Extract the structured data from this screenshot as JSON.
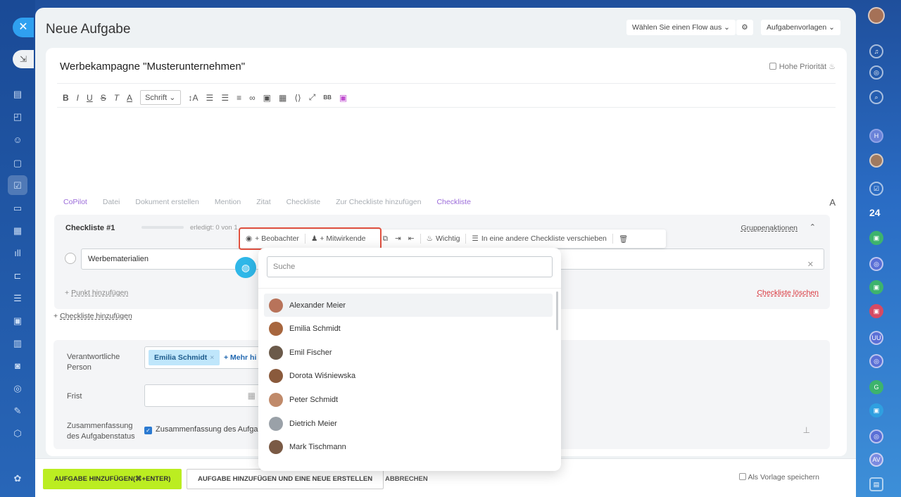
{
  "title": "Neue Aufgabe",
  "flow_select": "Wählen Sie einen Flow aus",
  "templates": "Aufgabenvorlagen",
  "task_name": "Werbekampagne \"Musterunternehmen\"",
  "high_priority": "Hohe Priorität",
  "font_select": "Schrift",
  "bottom_toolbar": [
    "CoPilot",
    "Datei",
    "Dokument erstellen",
    "Mention",
    "Zitat",
    "Checkliste",
    "Zur Checkliste hinzufügen",
    "Checkliste"
  ],
  "checklist": {
    "title": "Checkliste #1",
    "done": "erledigt: 0 von 1",
    "group_actions": "Gruppenaktionen",
    "item": "Werbematerialien",
    "add_point": "Punkt hinzufügen",
    "delete": "Checkliste löschen"
  },
  "add_checklist": "Checkliste hinzufügen",
  "popbar": {
    "observer": "+ Beobachter",
    "participants": "+ Mitwirkende",
    "important": "Wichtig",
    "move": "In eine andere Checkliste verschieben"
  },
  "search_placeholder": "Suche",
  "people": [
    {
      "name": "Alexander Meier",
      "color": "#b8735a"
    },
    {
      "name": "Emilia Schmidt",
      "color": "#a7663e"
    },
    {
      "name": "Emil Fischer",
      "color": "#6b5a4a"
    },
    {
      "name": "Dorota Wiśniewska",
      "color": "#8a5a3c"
    },
    {
      "name": "Peter Schmidt",
      "color": "#c08a6a"
    },
    {
      "name": "Dietrich Meier",
      "color": "#9aa1a8"
    },
    {
      "name": "Mark Tischmann",
      "color": "#7a5a45"
    }
  ],
  "fields": {
    "responsible_label": "Verantwortliche Person",
    "responsible_tag": "Emilia Schmidt",
    "more": "+ Mehr hi",
    "deadline_label": "Frist",
    "summary_label": "Zusammenfassung des Aufgabenstatus",
    "summary_text": "Zusammenfassung des Aufga"
  },
  "footer": {
    "add": "AUFGABE HINZUFÜGEN(⌘+ENTER)",
    "add_new": "AUFGABE HINZUFÜGEN UND EINE NEUE ERSTELLEN",
    "cancel": "ABBRECHEN",
    "save_template": "Als Vorlage speichern"
  },
  "right_counter": "24"
}
